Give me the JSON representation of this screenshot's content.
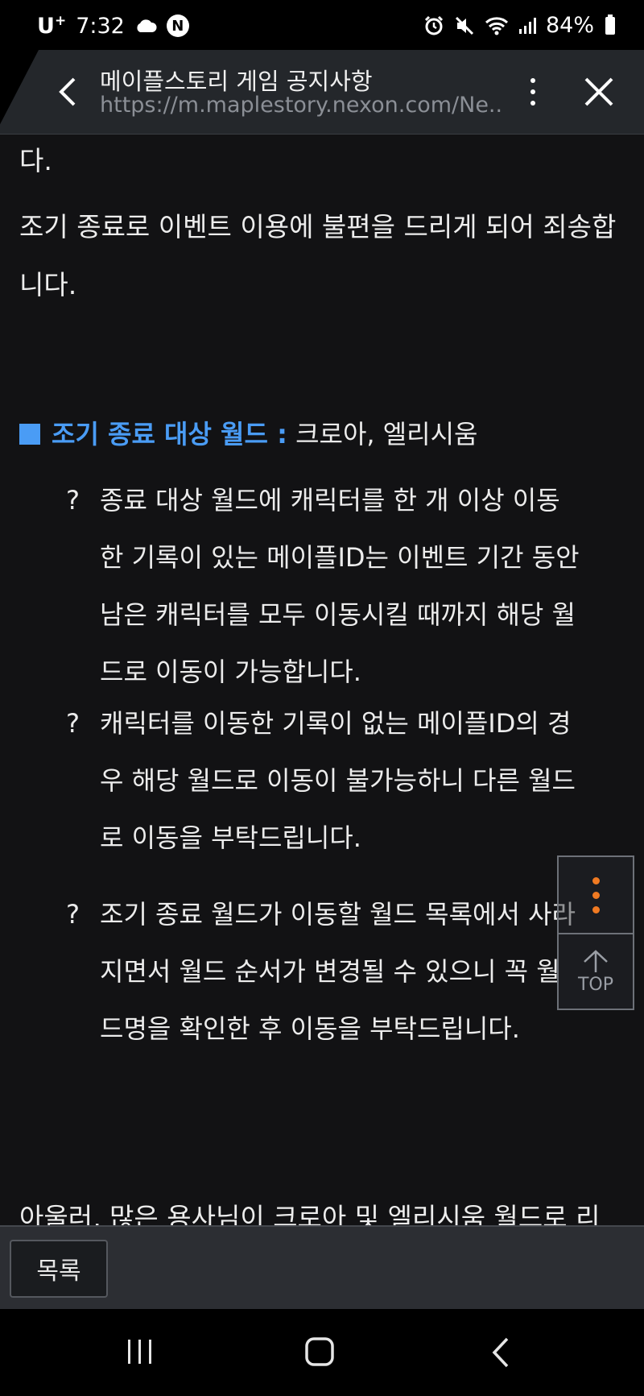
{
  "status_bar": {
    "carrier": "U",
    "carrier_sup": "+",
    "time": "7:32",
    "badge": "N",
    "battery": "84%"
  },
  "browser": {
    "title": "메이플스토리 게임 공지사항",
    "url": "https://m.maplestory.nexon.com/Ne..."
  },
  "article": {
    "line_top": "다.",
    "para1": "조기 종료로 이벤트 이용에 불편을 드리게 되어 죄송합니다.",
    "section_label": "조기 종료 대상 월드 :",
    "section_value": " 크로아, 엘리시움",
    "bullet_mark": "?",
    "bullets": [
      "종료 대상 월드에 캐릭터를 한 개 이상 이동한 기록이 있는 메이플ID는 이벤트 기간 동안 남은 캐릭터를 모두 이동시킬 때까지 해당 월드로 이동이 가능합니다.",
      "캐릭터를 이동한 기록이 없는 메이플ID의 경우 해당 월드로 이동이 불가능하니 다른 월드로 이동을 부탁드립니다.",
      "조기 종료 월드가 이동할 월드 목록에서 사라지면서 월드 순서가 변경될 수 있으니 꼭 월드명을 확인한 후 이동을 부탁드립니다."
    ],
    "para_bottom": "아울러, 많은 용사님이 크로아 및 엘리시움 월드로 리"
  },
  "float": {
    "top_label": "TOP"
  },
  "bottom_bar": {
    "list_label": "목록"
  },
  "colors": {
    "accent_blue": "#4a9cf5",
    "menu_orange": "#f07a22"
  }
}
